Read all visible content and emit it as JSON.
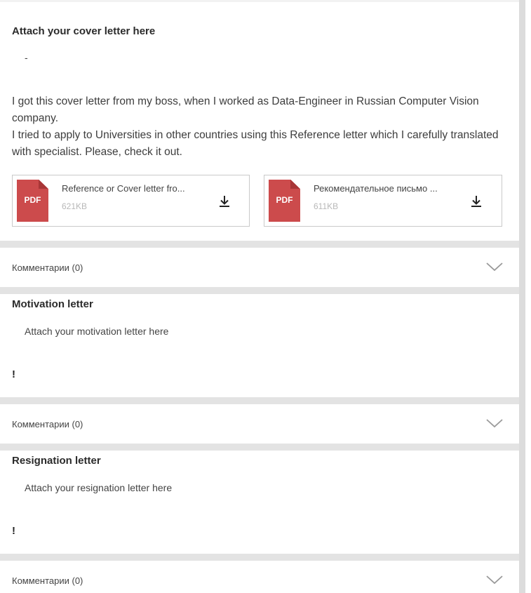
{
  "cover_section": {
    "title": "Attach your cover letter here",
    "dash": "-",
    "paragraph_1": "I got this cover letter from my boss, when I worked as Data-Engineer in Russian Computer Vision company.",
    "paragraph_2": "I tried to apply to Universities in other countries using this Reference letter which I carefully translated with specialist. Please, check it out.",
    "attachments": [
      {
        "icon": "pdf-icon",
        "type_label": "PDF",
        "name": "Reference or Cover letter fro...",
        "size": "621KB",
        "action_icon": "download-icon"
      },
      {
        "icon": "pdf-icon",
        "type_label": "PDF",
        "name": "Рекомендательное письмо ...",
        "size": "611KB",
        "action_icon": "download-icon"
      }
    ]
  },
  "comments_1": {
    "label": "Комментарии (0)",
    "icon": "chevron-down-icon"
  },
  "motivation_section": {
    "title": "Motivation letter",
    "subtitle": "Attach your motivation letter here",
    "content": "!"
  },
  "comments_2": {
    "label": "Комментарии (0)",
    "icon": "chevron-down-icon"
  },
  "resignation_section": {
    "title": "Resignation letter",
    "subtitle": "Attach your resignation letter here",
    "content": "!"
  },
  "comments_3": {
    "label": "Комментарии (0)",
    "icon": "chevron-down-icon"
  },
  "colors": {
    "page_background": "#e3e3e3",
    "card_background": "#ffffff",
    "pdf_red": "#cc4b4c",
    "muted_text": "#b8b8b8"
  }
}
